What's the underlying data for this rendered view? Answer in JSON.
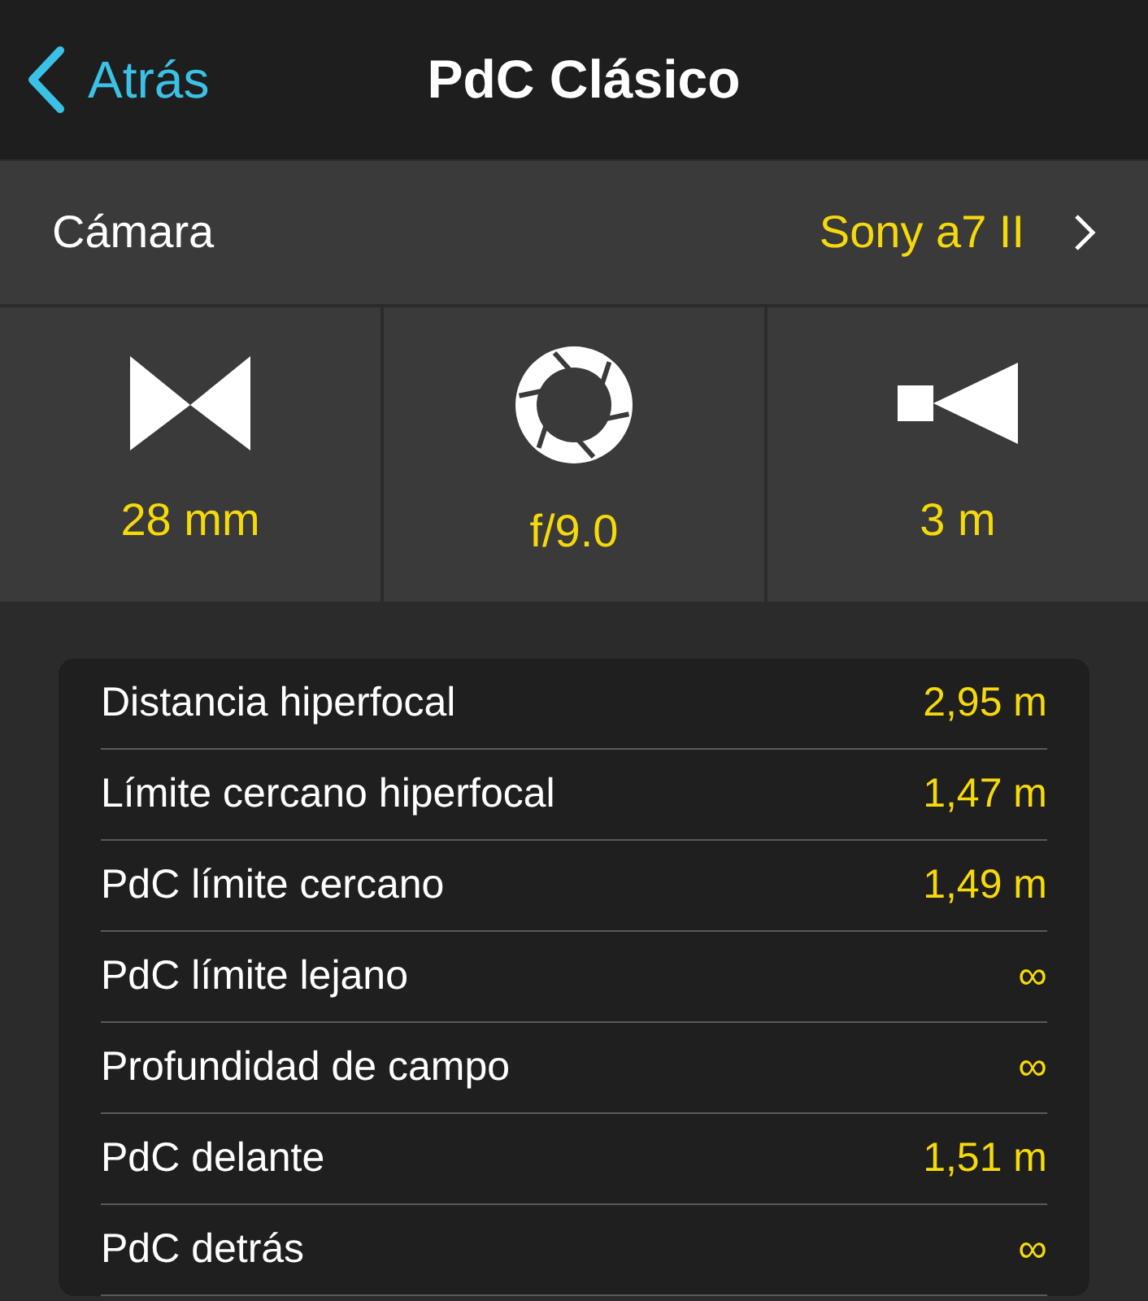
{
  "nav": {
    "back": "Atrás",
    "title": "PdC Clásico"
  },
  "camera": {
    "label": "Cámara",
    "value": "Sony a7 II"
  },
  "params": [
    {
      "kind": "focal",
      "value": "28 mm"
    },
    {
      "kind": "aperture",
      "value": "f/9.0"
    },
    {
      "kind": "distance",
      "value": "3 m"
    }
  ],
  "results": [
    {
      "label": "Distancia hiperfocal",
      "value": "2,95 m"
    },
    {
      "label": "Límite cercano hiperfocal",
      "value": "1,47 m"
    },
    {
      "label": "PdC límite cercano",
      "value": "1,49 m"
    },
    {
      "label": "PdC límite lejano",
      "value": "∞"
    },
    {
      "label": "Profundidad de campo",
      "value": "∞"
    },
    {
      "label": "PdC delante",
      "value": "1,51 m"
    },
    {
      "label": "PdC detrás",
      "value": "∞"
    }
  ]
}
